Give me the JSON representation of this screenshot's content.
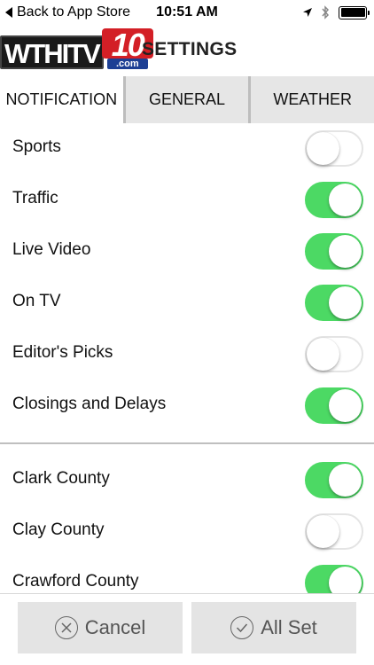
{
  "status_bar": {
    "back_label": "Back to App Store",
    "time": "10:51 AM"
  },
  "header": {
    "logo": {
      "wordmark": "WTHITV",
      "channel": "10",
      "domain": ".com"
    },
    "title": "SETTINGS"
  },
  "tabs": [
    {
      "label": "NOTIFICATION",
      "active": true
    },
    {
      "label": "GENERAL",
      "active": false
    },
    {
      "label": "WEATHER",
      "active": false
    }
  ],
  "notifications": [
    {
      "label": "Sports",
      "enabled": false
    },
    {
      "label": "Traffic",
      "enabled": true
    },
    {
      "label": "Live Video",
      "enabled": true
    },
    {
      "label": "On TV",
      "enabled": true
    },
    {
      "label": "Editor's Picks",
      "enabled": false
    },
    {
      "label": "Closings and Delays",
      "enabled": true
    }
  ],
  "counties": [
    {
      "label": "Clark County",
      "enabled": true
    },
    {
      "label": "Clay County",
      "enabled": false
    },
    {
      "label": "Crawford County",
      "enabled": true
    }
  ],
  "buttons": {
    "cancel_label": "Cancel",
    "allset_label": "All Set"
  },
  "colors": {
    "toggle_on": "#4cd964",
    "toggle_off_border": "#e4e4e4",
    "brand_red": "#d31f26",
    "brand_blue": "#1c3f94"
  },
  "icons": {
    "status_bar": [
      "back-triangle-icon",
      "location-arrow-icon",
      "bluetooth-icon",
      "battery-icon"
    ],
    "cancel": "x-circle-icon",
    "allset": "check-circle-icon"
  }
}
